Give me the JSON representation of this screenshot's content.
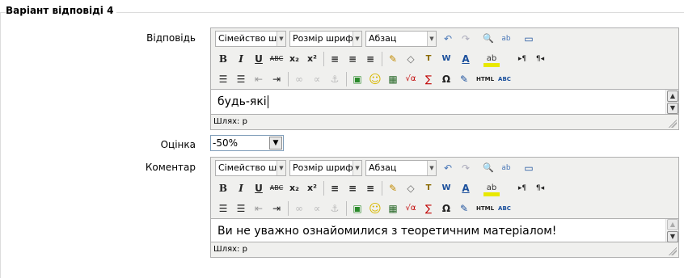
{
  "legend": "Варіант відповіді 4",
  "answer": {
    "label": "Відповідь",
    "text": "будь-які",
    "path_label": "Шлях: p"
  },
  "grade": {
    "label": "Оцінка",
    "value": "-50%"
  },
  "feedback": {
    "label": "Коментар",
    "text": "Ви не уважно ознайомилися з теоретичним матеріалом!",
    "path_label": "Шлях: p"
  },
  "toolbar": {
    "font_family": "Сімейство шри",
    "font_size": "Розмір шрифта",
    "format": "Абзац",
    "icons": {
      "undo": "↶",
      "redo": "↷",
      "find": "🔍",
      "replace": "ab",
      "fullscreen": "▭",
      "bold": "B",
      "italic": "I",
      "underline": "U",
      "strike": "ABC",
      "subscript": "x₂",
      "superscript": "x²",
      "align_left": "≡",
      "align_center": "≡",
      "align_right": "≡",
      "cleanup": "✎",
      "eraser": "◇",
      "paste_text": "T",
      "paste_word": "W",
      "font_color": "A",
      "bg_color": "ab",
      "ltr": "▸¶",
      "rtl": "¶◂",
      "bullets": "☰",
      "numbers": "☰",
      "outdent": "⇤",
      "indent": "⇥",
      "link": "∞",
      "unlink": "∝",
      "anchor": "⚓",
      "image": "▣",
      "emoticon": "☺",
      "media": "▦",
      "equation": "√α",
      "tex": "∑",
      "charmap": "Ω",
      "edit": "✎",
      "html": "HTML",
      "spell": "ABC"
    }
  }
}
